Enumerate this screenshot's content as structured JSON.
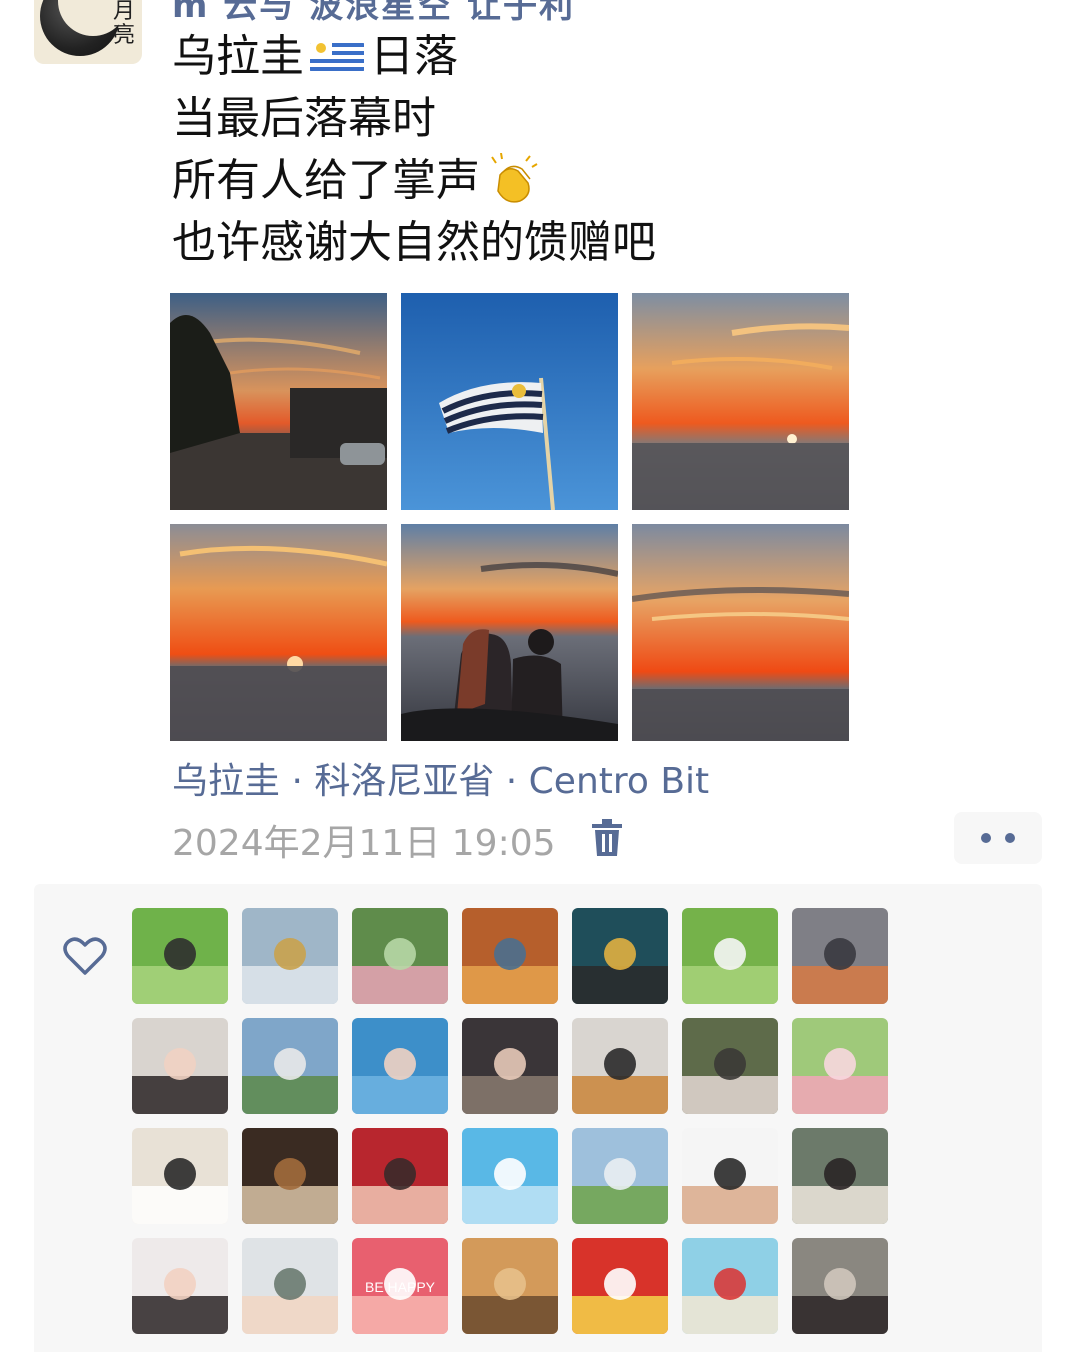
{
  "post": {
    "author_name_partial": "m  云与  波浪星空  让子利",
    "avatar_label": "月亮",
    "lines": [
      {
        "text_before": "乌拉圭",
        "emoji": "uruguay-flag",
        "text_after": "日落"
      },
      {
        "text_before": "当最后落幕时",
        "emoji": "",
        "text_after": ""
      },
      {
        "text_before": "所有人给了掌声",
        "emoji": "clapping-hands",
        "text_after": ""
      },
      {
        "text_before": "也许感谢大自然的馈赠吧",
        "emoji": "",
        "text_after": ""
      }
    ],
    "photos": [
      {
        "name": "photo-street-sunset",
        "scene": "street"
      },
      {
        "name": "photo-uruguay-flag",
        "scene": "flag"
      },
      {
        "name": "photo-sea-sunset-1",
        "scene": "sea"
      },
      {
        "name": "photo-sea-sunset-2",
        "scene": "sea2"
      },
      {
        "name": "photo-couple-sunset",
        "scene": "couple"
      },
      {
        "name": "photo-sea-sunset-3",
        "scene": "sea3"
      }
    ],
    "location": "乌拉圭 · 科洛尼亚省 · Centro Bit",
    "timestamp": "2024年2月11日 19:05"
  },
  "colors": {
    "link_blue": "#576b95",
    "timestamp_gray": "#a6a6a6",
    "panel_bg": "#f7f7f7"
  },
  "icons": {
    "delete": "trash-icon",
    "more": "more-dots-icon",
    "like": "heart-icon"
  },
  "likers": [
    [
      "green",
      "cloud",
      "lotus",
      "orange",
      "navy",
      "field",
      "dusk"
    ],
    [
      "girl-dark",
      "lake",
      "sea-blue",
      "indoor",
      "dog",
      "tree",
      "pink-cartoon"
    ],
    [
      "snoopy",
      "tea",
      "red-costume",
      "sky",
      "hills",
      "hand",
      "girl-light"
    ],
    [
      "girl-smile",
      "mist",
      "be-happy",
      "baobab",
      "red-cartoon",
      "beach",
      "desk"
    ]
  ],
  "be_happy_text": "BE HAPPY"
}
